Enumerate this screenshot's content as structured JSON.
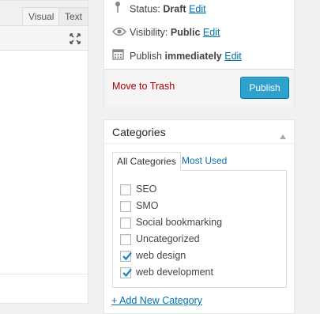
{
  "editor": {
    "tabs": {
      "visual": "Visual",
      "text": "Text"
    }
  },
  "publish": {
    "status_label": "Status:",
    "status_value": "Draft",
    "visibility_label": "Visibility:",
    "visibility_value": "Public",
    "publish_label": "Publish",
    "publish_value": "immediately",
    "edit_link": "Edit",
    "trash_label": "Move to Trash",
    "publish_button": "Publish"
  },
  "categories": {
    "title": "Categories",
    "tabs": {
      "all": "All Categories",
      "most_used": "Most Used"
    },
    "items": [
      {
        "label": "SEO",
        "checked": false
      },
      {
        "label": "SMO",
        "checked": false
      },
      {
        "label": "Social bookmarking",
        "checked": false
      },
      {
        "label": "Uncategorized",
        "checked": false
      },
      {
        "label": "web design",
        "checked": true
      },
      {
        "label": "web development",
        "checked": true
      }
    ],
    "add_new": "+ Add New Category"
  },
  "colors": {
    "accent": "#0073aa",
    "button": "#2ea2cc",
    "trash": "#aa0000"
  }
}
